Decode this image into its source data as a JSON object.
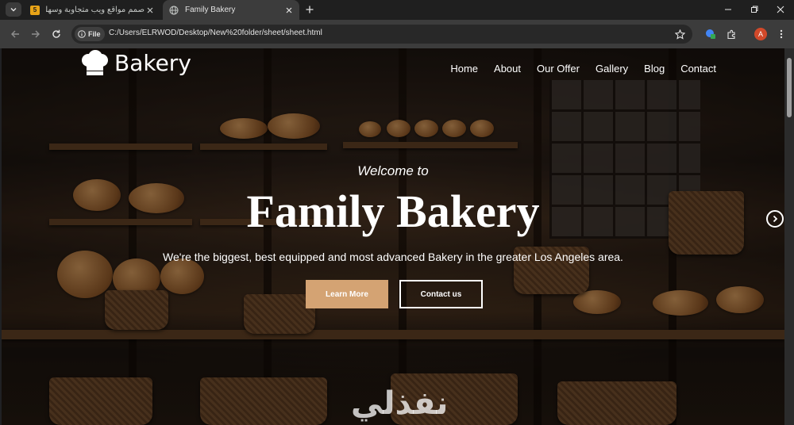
{
  "browser": {
    "tabs": [
      {
        "title": "صمم مواقع ويب متجاوبة وسهلة",
        "favicon": "5",
        "active": false
      },
      {
        "title": "Family Bakery",
        "favicon": "globe-icon",
        "active": true
      }
    ],
    "site_chip": "File",
    "url": "C:/Users/ELRWOD/Desktop/New%20folder/sheet/sheet.html",
    "profile_initial": "A"
  },
  "site": {
    "logo": "Bakery",
    "nav": [
      "Home",
      "About",
      "Our Offer",
      "Gallery",
      "Blog",
      "Contact"
    ],
    "hero": {
      "welcome": "Welcome to",
      "title": "Family Bakery",
      "subtitle": "We're the biggest, best equipped and most advanced Bakery in the greater Los Angeles area.",
      "learn_more": "Learn More",
      "contact": "Contact us"
    },
    "watermark": "نفذلي"
  },
  "colors": {
    "accent": "#d4a373",
    "browser_dark": "#1f1f1f",
    "toolbar": "#3c3c3c"
  }
}
